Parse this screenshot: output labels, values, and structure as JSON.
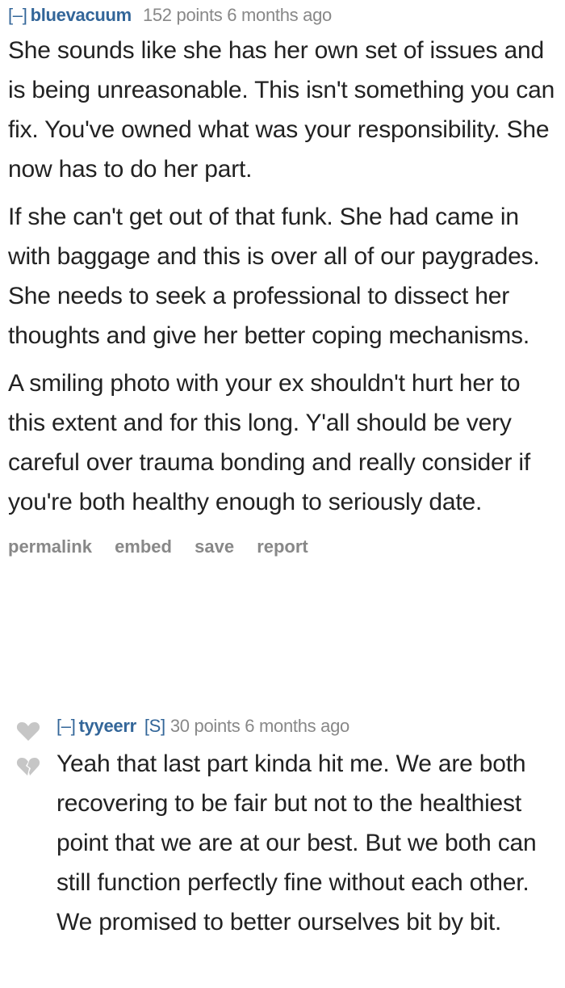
{
  "comments": [
    {
      "expand": "[–]",
      "author": "bluevacuum",
      "submitter": "",
      "score": "152 points",
      "time": "6 months ago",
      "paragraphs": [
        "She sounds like she has her own set of issues and is being unreasonable. This isn't something you can fix. You've owned what was your responsibility. She now has to do her part.",
        "If she can't get out of that funk. She had came in with baggage and this is over all of our paygrades. She needs to seek a professional to dissect her thoughts and give her better coping mechanisms.",
        "A smiling photo with your ex shouldn't hurt her to this extent and for this long. Y'all should be very careful over trauma bonding and really consider if you're both healthy enough to seriously date."
      ],
      "buttons": [
        "permalink",
        "embed",
        "save",
        "report"
      ]
    },
    {
      "expand": "[–]",
      "author": "tyyeerr",
      "submitter": "[S]",
      "score": "30 points",
      "time": "6 months ago",
      "paragraphs": [
        "Yeah that last part kinda hit me. We are both recovering to be fair but not to the healthiest point that we are at our best. But we both can still function perfectly fine without each other. We promised to better ourselves bit by bit."
      ],
      "upvote_icon": "heart-icon",
      "downvote_icon": "broken-heart-icon",
      "icon_color": "#c6c6c6"
    }
  ]
}
